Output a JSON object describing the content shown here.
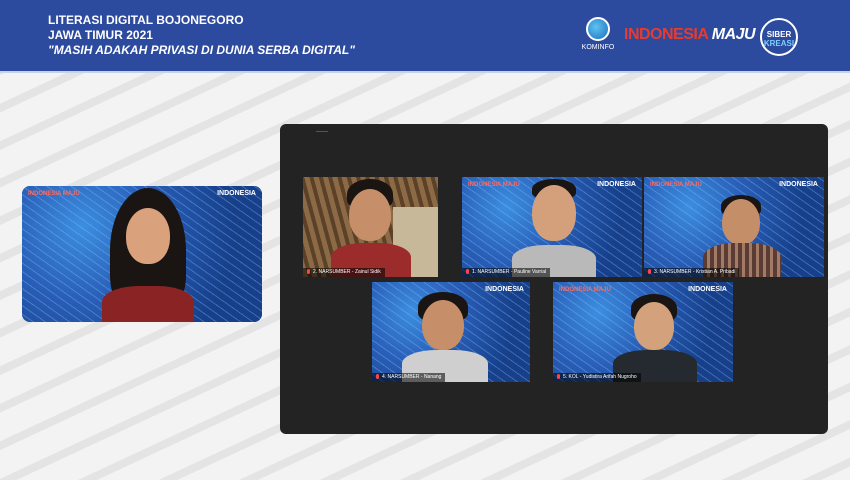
{
  "header": {
    "line1": "LITERASI DIGITAL BOJONEGORO",
    "line2": "JAWA TIMUR 2021",
    "line3": "\"MASIH ADAKAH PRIVASI DI DUNIA SERBA DIGITAL\""
  },
  "logos": {
    "kominfo": "KOMINFO",
    "indonesia": "INDONESIA",
    "maju": "MAJU",
    "siber": "SIBER",
    "kreasi": "KREASI"
  },
  "tiles": {
    "brand": "INDONESIA",
    "brand_small": "INDONESIA MAJU",
    "p1_name": "2. NARSUMBER - Zainul Sidik",
    "p2_name": "1. NARSUMBER - Pauline Varrial",
    "p3_name": "3. NARSUMBER - Kristian A. Pribadi",
    "p4_name": "4. NARSUMBER - Nanang",
    "p5_name": "5. KOL - Yudistira Arifah Nugroho"
  },
  "colors": {
    "header_bg": "#2c4a9e",
    "panel_bg": "#232323",
    "tile_bg": "#1d4fa0"
  }
}
